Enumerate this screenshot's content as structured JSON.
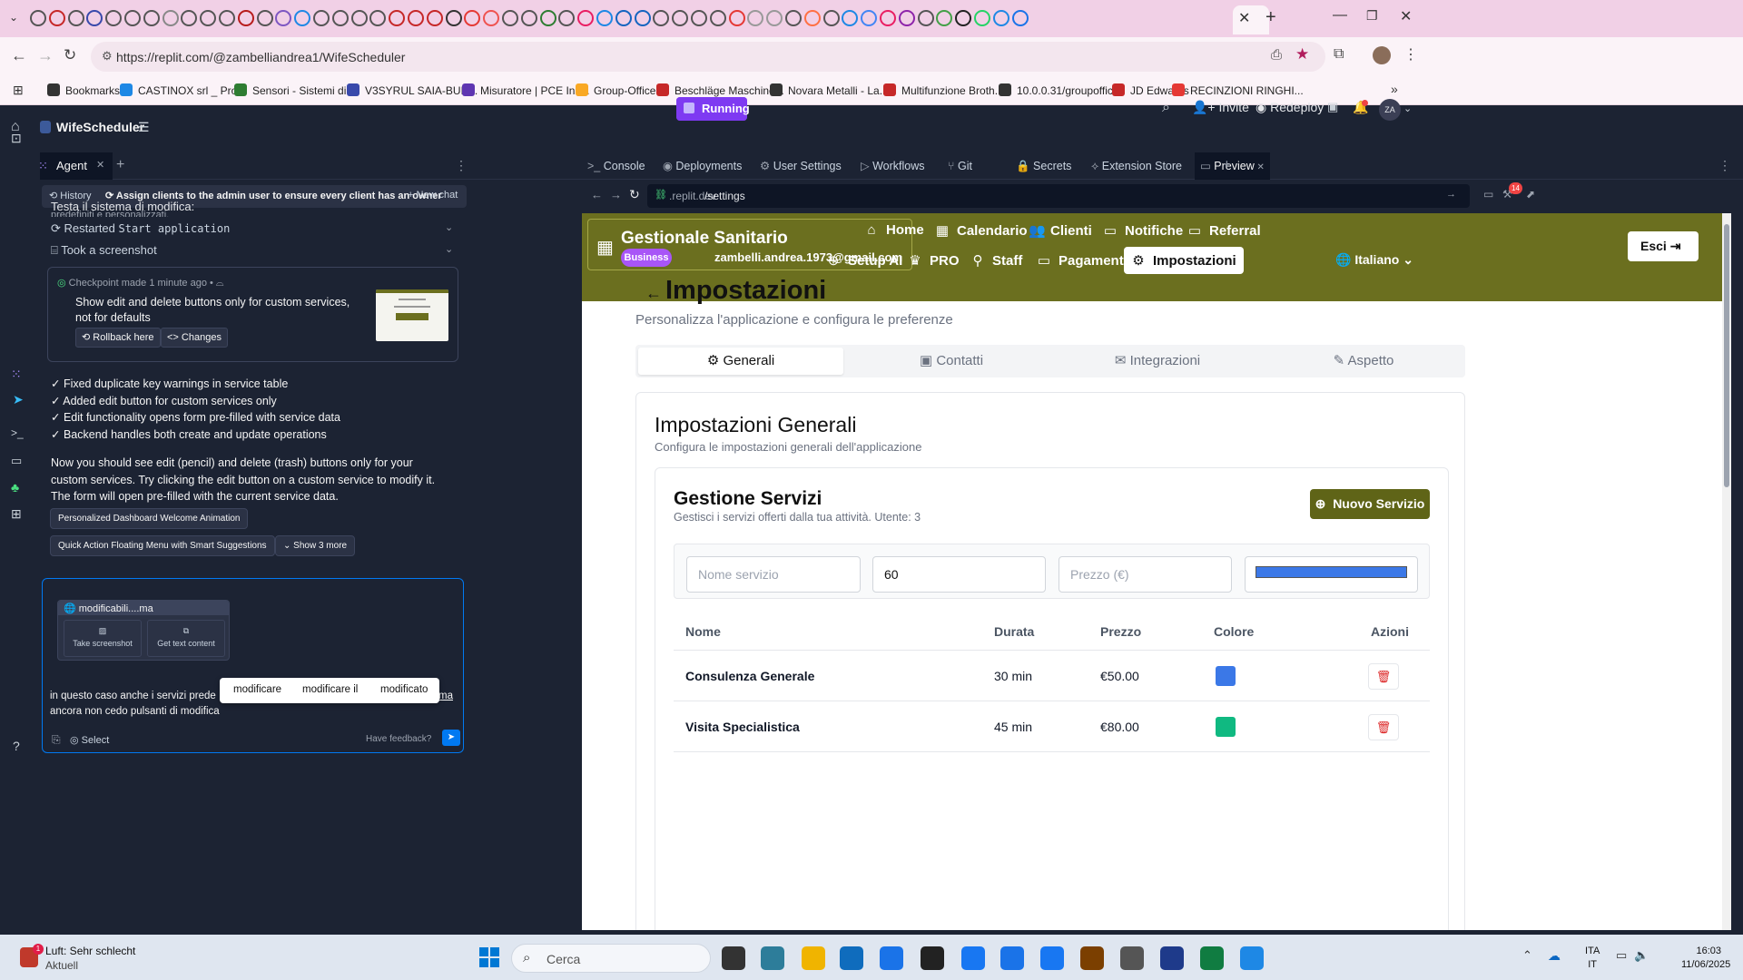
{
  "browser": {
    "url": "https://replit.com/@zambelliandrea1/WifeScheduler",
    "bookmarks": [
      "Bookmarks",
      "CASTINOX srl _ Pro...",
      "Sensori - Sistemi di...",
      "V3SYRUL SAIA-BUR...",
      "Misuratore | PCE Ins...",
      "Group-Office",
      "Beschläge Maschine...",
      "Novara Metalli - La...",
      "Multifunzione Broth...",
      "10.0.0.31/groupoffic...",
      "JD Edwards",
      "RECINZIONI RINGHI..."
    ]
  },
  "replit": {
    "project": "WifeScheduler",
    "status": "Running",
    "invite": "Invite",
    "redeploy": "Redeploy",
    "avatar": "ZA",
    "agent_tab": "Agent",
    "history": "History",
    "thread_title": "Assign clients to the admin user to ensure every client has an owner",
    "new_chat": "New chat",
    "ide_tabs": [
      "Console",
      "Deployments",
      "User Settings",
      "Workflows",
      "Git",
      "Secrets",
      "Extension Store",
      "Preview"
    ],
    "preview_url_host": ".replit.dev",
    "preview_url_path": "/settings",
    "notif_count": "14"
  },
  "agent": {
    "partial_line": "predefiniti e personalizzati.",
    "test_line": "Testa il sistema di modifica:",
    "step1_label": "Restarted",
    "step1_code": "Start application",
    "step2": "Took a screenshot",
    "checkpoint_meta": "Checkpoint made 1 minute ago",
    "checkpoint_desc": "Show edit and delete buttons only for custom services, not for defaults",
    "rollback": "Rollback here",
    "changes": "Changes",
    "bullets": [
      "✓ Fixed duplicate key warnings in service table",
      "✓ Added edit button for custom services only",
      "✓ Edit functionality opens form pre-filled with service data",
      "✓ Backend handles both create and update operations"
    ],
    "summary": "Now you should see edit (pencil) and delete (trash) buttons only for your custom services. Try clicking the edit button on a custom service to modify it. The form will open pre-filled with the current service data.",
    "suggestion1": "Personalized Dashboard Welcome Animation",
    "suggestion2": "Quick Action Floating Menu with Smart Suggestions",
    "show_more": "Show 3 more",
    "attachment": "modificabili....ma",
    "take_screenshot": "Take screenshot",
    "get_text": "Get text content",
    "input_line1": "in questo caso anche i servizi prede",
    "input_tail": "ma",
    "input_line2": "ancora non cedo pulsanti di modifica",
    "spell": [
      "modificare",
      "modificare il",
      "modificato"
    ],
    "select": "Select",
    "feedback": "Have feedback?"
  },
  "app": {
    "brand": "Gestionale Sanitario",
    "badge": "Business",
    "email": "zambelli.andrea.1973@gmail.com",
    "nav_row1": [
      "Home",
      "Calendario",
      "Clienti",
      "Notifiche",
      "Referral"
    ],
    "nav_row2": [
      "Setup AI",
      "PRO",
      "Staff",
      "Pagamenti",
      "Impostazioni"
    ],
    "language": "Italiano",
    "logout": "Esci",
    "page_title": "Impostazioni",
    "page_subtitle": "Personalizza l'applicazione e configura le preferenze",
    "tabs": [
      "Generali",
      "Contatti",
      "Integrazioni",
      "Aspetto"
    ],
    "card_title": "Impostazioni Generali",
    "card_subtitle": "Configura le impostazioni generali dell'applicazione",
    "services_title": "Gestione Servizi",
    "services_subtitle": "Gestisci i servizi offerti dalla tua attività. Utente: 3",
    "new_service": "Nuovo Servizio",
    "form": {
      "name_placeholder": "Nome servizio",
      "duration_value": "60",
      "price_placeholder": "Prezzo (€)",
      "color_value": "#3b78e7"
    },
    "table_headers": [
      "Nome",
      "Durata",
      "Prezzo",
      "Colore",
      "Azioni"
    ],
    "rows": [
      {
        "name": "Consulenza Generale",
        "duration": "30 min",
        "price": "€50.00",
        "color": "#3b78e7"
      },
      {
        "name": "Visita Specialistica",
        "duration": "45 min",
        "price": "€80.00",
        "color": "#10b981"
      }
    ]
  },
  "taskbar": {
    "weather_title": "Luft: Sehr schlecht",
    "weather_sub": "Aktuell",
    "search": "Cerca",
    "lang1": "ITA",
    "lang2": "IT",
    "time": "16:03",
    "date": "11/06/2025"
  }
}
